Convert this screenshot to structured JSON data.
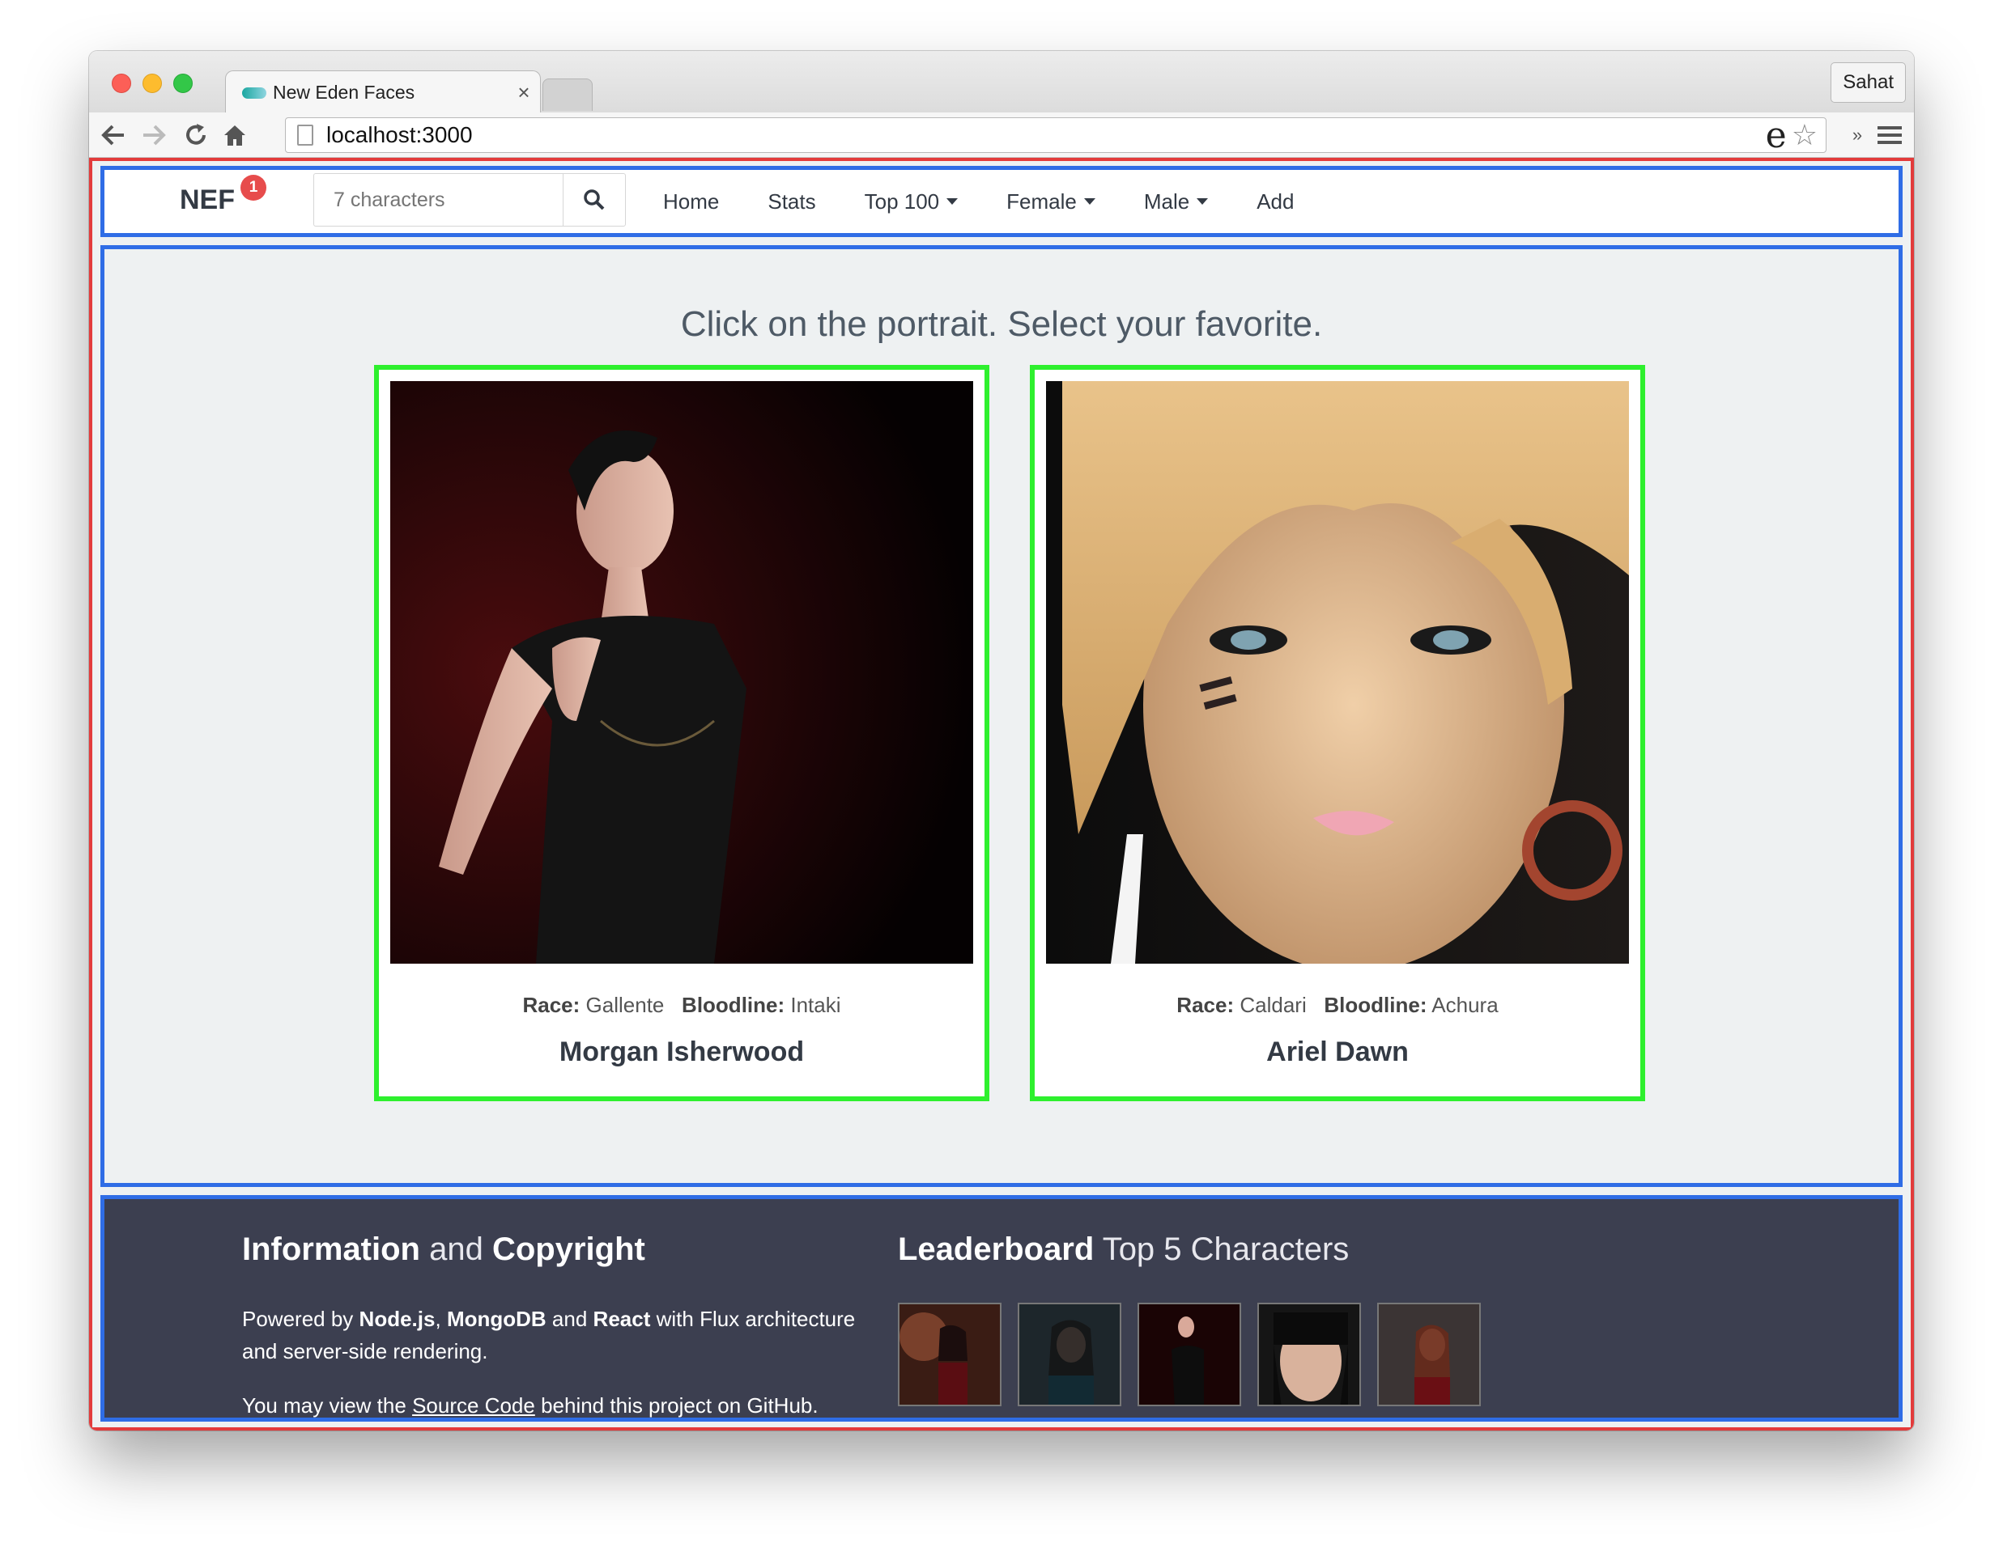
{
  "browser": {
    "tab_title": "New Eden Faces",
    "tab_close": "×",
    "profile": "Sahat",
    "url": "localhost:3000"
  },
  "navbar": {
    "brand": "NEF",
    "badge": "1",
    "search_placeholder": "7 characters",
    "items": [
      {
        "label": "Home"
      },
      {
        "label": "Stats"
      },
      {
        "label": "Top 100"
      },
      {
        "label": "Female"
      },
      {
        "label": "Male"
      },
      {
        "label": "Add"
      }
    ]
  },
  "main": {
    "headline": "Click on the portrait. Select your favorite.",
    "race_label": "Race:",
    "bloodline_label": "Bloodline:",
    "characters": [
      {
        "name": "Morgan Isherwood",
        "race": "Gallente",
        "bloodline": "Intaki"
      },
      {
        "name": "Ariel Dawn",
        "race": "Caldari",
        "bloodline": "Achura"
      }
    ]
  },
  "footer": {
    "info_bold": "Information",
    "info_and": "and",
    "info_bold2": "Copyright",
    "powered_by": "Powered by",
    "node": "Node.js",
    "comma": ",",
    "mongo": "MongoDB",
    "and": "and",
    "react": "React",
    "with_flux": "with Flux architecture and server-side rendering.",
    "view_prefix": "You may view the",
    "source_code": "Source Code",
    "view_suffix": "behind this project on GitHub.",
    "leaderboard_bold": "Leaderboard",
    "leaderboard_light": "Top 5 Characters"
  },
  "colors": {
    "nav_border": "#2f6de6",
    "outer_border": "#e33b3b",
    "card_border": "#2ef02e",
    "footer_bg": "#3c3f50",
    "badge": "#e74c4c"
  }
}
